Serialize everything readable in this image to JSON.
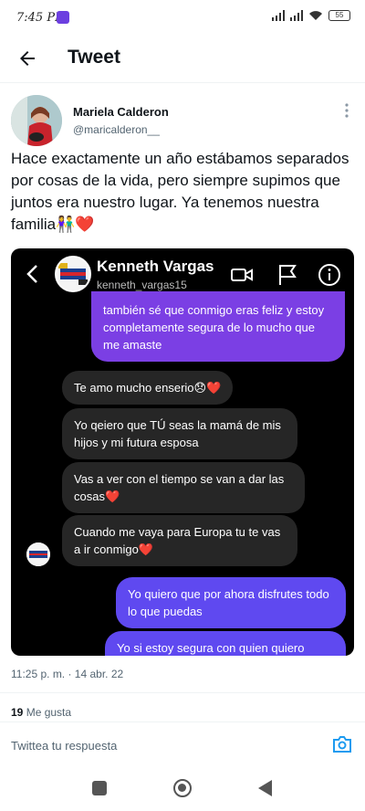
{
  "status": {
    "time": "7:45 PM",
    "battery": "55"
  },
  "header": {
    "title": "Tweet"
  },
  "author": {
    "name": "Mariela Calderon",
    "handle": "@maricalderon__"
  },
  "tweet": {
    "text": "Hace exactamente un año estábamos separados por cosas de la vida, pero siempre supimos que juntos era nuestro lugar. Ya tenemos nuestra familia👫❤️",
    "timestamp": "11:25 p. m. · 14 abr. 22",
    "likes_count": "19",
    "likes_label": " Me gusta"
  },
  "media": {
    "chat_name": "Kenneth Vargas",
    "chat_username": "kenneth_vargas15",
    "messages": [
      {
        "from": "me",
        "text": "también sé que conmigo eras feliz y estoy completamente segura de lo mucho que me amaste"
      },
      {
        "from": "other",
        "text": "Te amo mucho enserio😞❤️"
      },
      {
        "from": "other",
        "text": "Yo qeiero que TÚ seas la mamá de mis hijos y mi futura esposa"
      },
      {
        "from": "other",
        "text": "Vas a ver con el tiempo se van a dar las cosas❤️"
      },
      {
        "from": "other",
        "text": "Cuando me vaya para Europa tu te vas a ir conmigo❤️"
      },
      {
        "from": "me",
        "text": "Yo quiero que por ahora disfrutes todo lo que puedas"
      },
      {
        "from": "me",
        "text": "Yo si estoy segura con quien quiero"
      }
    ]
  },
  "reply": {
    "placeholder": "Twittea tu respuesta"
  },
  "colors": {
    "accent": "#1d9bf0",
    "bubble_sent": "#7b3fe4",
    "bubble_received": "#262626"
  }
}
